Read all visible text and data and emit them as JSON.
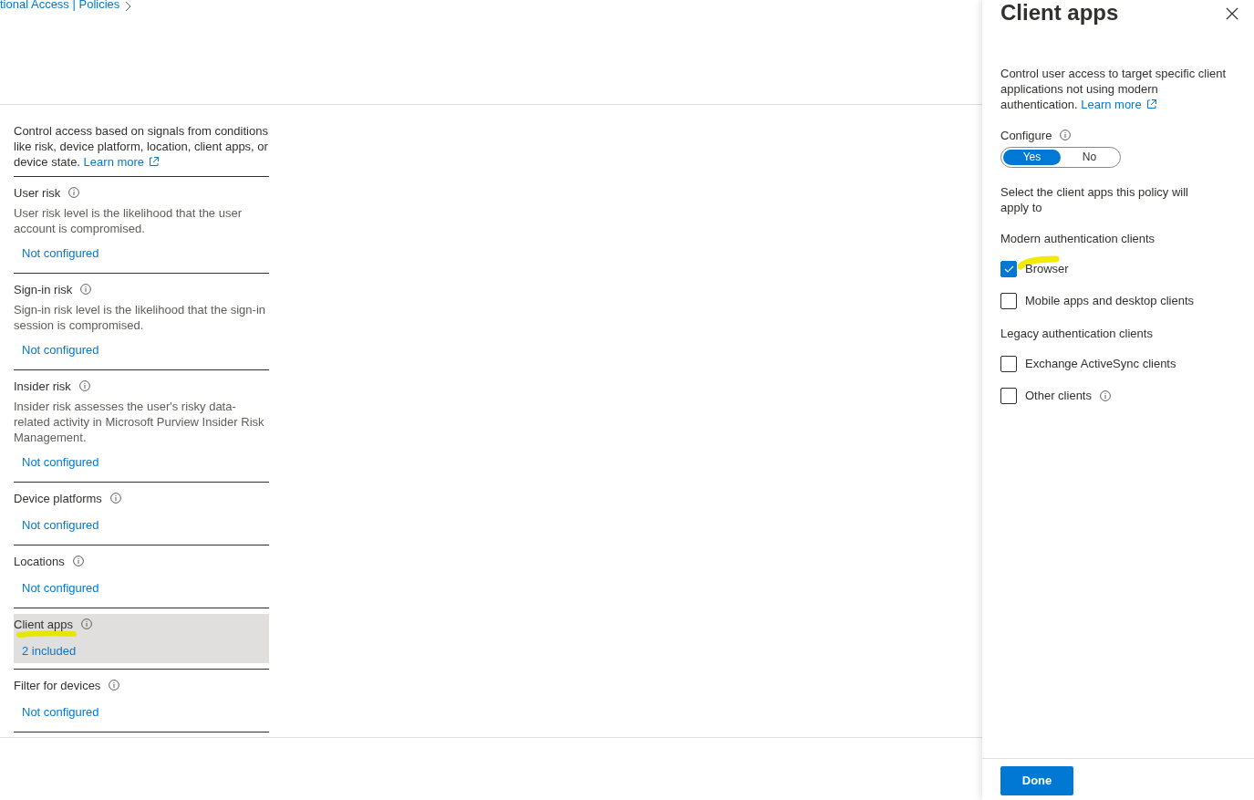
{
  "breadcrumb": {
    "text": "tional Access | Policies"
  },
  "conditions": {
    "intro": "Control access based on signals from conditions like risk, device platform, location, client apps, or device state.",
    "learn_more": "Learn more",
    "items": [
      {
        "label": "User risk",
        "description": "User risk level is the likelihood that the user account is compromised.",
        "value": "Not configured",
        "selected": false,
        "highlighted": false
      },
      {
        "label": "Sign-in risk",
        "description": "Sign-in risk level is the likelihood that the sign-in session is compromised.",
        "value": "Not configured",
        "selected": false,
        "highlighted": false
      },
      {
        "label": "Insider risk",
        "description": "Insider risk assesses the user's risky data-related activity in Microsoft Purview Insider Risk Management.",
        "value": "Not configured",
        "selected": false,
        "highlighted": false
      },
      {
        "label": "Device platforms",
        "value": "Not configured",
        "selected": false,
        "highlighted": false
      },
      {
        "label": "Locations",
        "value": "Not configured",
        "selected": false,
        "highlighted": false
      },
      {
        "label": "Client apps",
        "value": "2 included",
        "selected": true,
        "highlighted": true
      },
      {
        "label": "Filter for devices",
        "value": "Not configured",
        "selected": false,
        "highlighted": false
      }
    ]
  },
  "panel": {
    "title": "Client apps",
    "description": "Control user access to target specific client applications not using modern authentication.",
    "learn_more": "Learn more",
    "configure": {
      "label": "Configure",
      "options": [
        {
          "label": "Yes",
          "selected": true
        },
        {
          "label": "No",
          "selected": false
        }
      ]
    },
    "instruction": "Select the client apps this policy will apply to",
    "groups": [
      {
        "heading": "Modern authentication clients",
        "options": [
          {
            "label": "Browser",
            "checked": true,
            "highlighted": true,
            "info": false
          },
          {
            "label": "Mobile apps and desktop clients",
            "checked": false,
            "highlighted": false,
            "info": false
          }
        ]
      },
      {
        "heading": "Legacy authentication clients",
        "options": [
          {
            "label": "Exchange ActiveSync clients",
            "checked": false,
            "highlighted": false,
            "info": false
          },
          {
            "label": "Other clients",
            "checked": false,
            "highlighted": false,
            "info": true
          }
        ]
      }
    ],
    "done": "Done"
  }
}
